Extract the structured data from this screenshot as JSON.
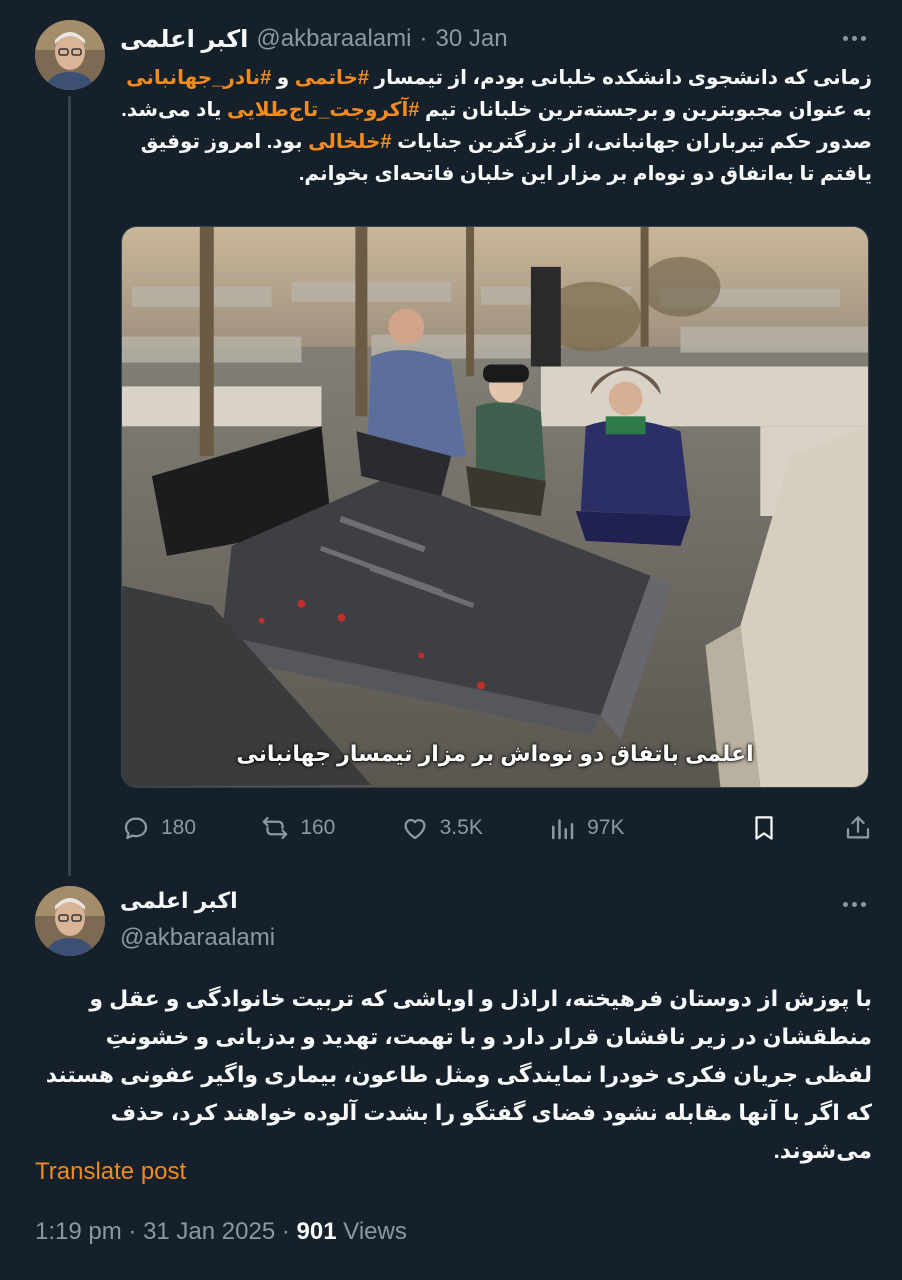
{
  "post1": {
    "author_name": "اکبر اعلمی",
    "handle": "@akbaraalami",
    "separator": "·",
    "date": "30 Jan",
    "text_parts": [
      {
        "t": "زمانی که دانشجوی دانشکده خلبانی بودم، از تیمسار ",
        "tag": false
      },
      {
        "t": "#خاتمی",
        "tag": true
      },
      {
        "t": " و ",
        "tag": false
      },
      {
        "t": "#نادر_جهانبانی",
        "tag": true
      },
      {
        "t": " به عنوان مجبوبترین و برجسته‌ترین خلبانان تیم ",
        "tag": false
      },
      {
        "t": "#آکروجت_تاج‌طلایی",
        "tag": true
      },
      {
        "t": " یاد می‌شد. صدور حکم تیرباران جهانبانی، از بزرگترین جنایات ",
        "tag": false
      },
      {
        "t": "#خلخالی",
        "tag": true
      },
      {
        "t": " بود. امروز توفیق یافتم تا به‌اتفاق دو نوه‌ام بر مزار این خلبان فاتحه‌ای بخوانم.",
        "tag": false
      }
    ],
    "photo_caption": "اعلمی باتفاق دو نوه‌اش بر مزار تیمسار جهانبانی",
    "stats": {
      "replies": "180",
      "reposts": "160",
      "likes": "3.5K",
      "views": "97K"
    }
  },
  "post2": {
    "author_name": "اکبر اعلمی",
    "handle": "@akbaraalami",
    "text": "با پوزش از دوستان فرهیخته، اراذل و اوباشی که تربیت خانوادگی و عقل و منطقشان در زیر نافشان قرار دارد و با تهمت، تهدید و بدزبانی و خشونتِ لفظی جریان فکری خودرا نمایندگی ومثل طاعون، بیماری واگیر عفونی هستند که اگر با آنها مقابله نشود فضای گفتگو را بشدت آلوده خواهند کرد، حذف می‌شوند.",
    "translate_label": "Translate post",
    "time": "1:19 pm",
    "separator": "·",
    "date": "31 Jan 2025",
    "views_count": "901",
    "views_label": "Views"
  },
  "colors": {
    "background": "#15202b",
    "accent": "#f28b1f",
    "muted": "#8b98a5"
  }
}
